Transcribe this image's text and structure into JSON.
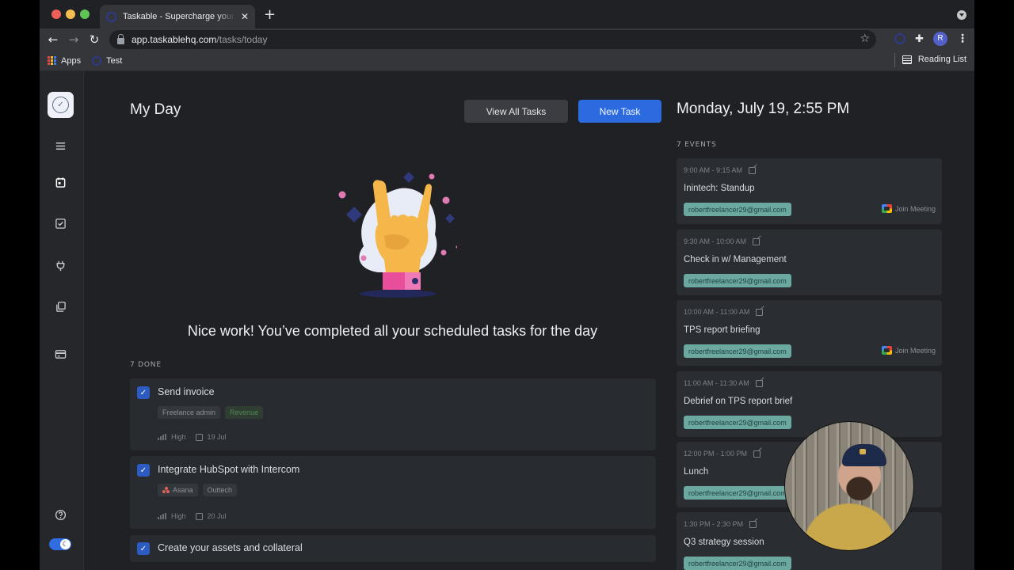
{
  "browser": {
    "tab_title": "Taskable - Supercharge your productivity",
    "tab_close": "✕",
    "new_tab": "+",
    "url_host": "app.taskablehq.com",
    "url_path": "/tasks/today",
    "back": "←",
    "forward": "→",
    "reload": "↻",
    "star": "☆",
    "puzzle": "✚",
    "profile_initial": "R",
    "menu": "⋮",
    "bookmarks": [
      {
        "label": "Apps"
      },
      {
        "label": "Test"
      }
    ],
    "reading_list": "Reading List"
  },
  "sidebar": {
    "logo_check": "✓",
    "items": [
      {
        "name": "menu"
      },
      {
        "name": "today"
      },
      {
        "name": "tasks"
      },
      {
        "name": "integrations"
      },
      {
        "name": "projects"
      },
      {
        "name": "billing"
      }
    ],
    "help": "?",
    "dark_mode_on": true,
    "moon": "☾"
  },
  "main": {
    "title": "My Day",
    "view_all_label": "View All Tasks",
    "new_task_label": "New Task",
    "celebrate": "Nice work! You’ve completed all your scheduled tasks for the day",
    "done_label": "7 DONE",
    "tasks": [
      {
        "title": "Send invoice",
        "checked": true,
        "tags": [
          "Freelance admin",
          "Revenue"
        ],
        "priority": "High",
        "due": "19 Jul"
      },
      {
        "title": "Integrate HubSpot with Intercom",
        "checked": true,
        "tags": [
          "Asana",
          "Outtech"
        ],
        "priority": "High",
        "due": "20 Jul"
      },
      {
        "title": "Create your assets and collateral",
        "checked": true
      }
    ],
    "check_glyph": "✓"
  },
  "events_panel": {
    "date": "Monday, July 19, 2:55 PM",
    "events_label": "7 EVENTS",
    "join_label": "Join Meeting",
    "events": [
      {
        "time": "9:00 AM - 9:15 AM",
        "title": "Inintech: Standup",
        "email": "robertfreelancer29@gmail.com",
        "join": true
      },
      {
        "time": "9:30 AM - 10:00 AM",
        "title": "Check in w/ Management",
        "email": "robertfreelancer29@gmail.com",
        "join": false
      },
      {
        "time": "10:00 AM - 11:00 AM",
        "title": "TPS report briefing",
        "email": "robertfreelancer29@gmail.com",
        "join": true
      },
      {
        "time": "11:00 AM - 11:30 AM",
        "title": "Debrief on TPS report brief",
        "email": "robertfreelancer29@gmail.com",
        "join": false
      },
      {
        "time": "12:00 PM - 1:00 PM",
        "title": "Lunch",
        "email": "robertfreelancer29@gmail.com",
        "join": false
      },
      {
        "time": "1:30 PM - 2:30 PM",
        "title": "Q3 strategy session",
        "email": "robertfreelancer29@gmail.com",
        "join": false
      }
    ]
  },
  "colors": {
    "accent": "#2c6ae0",
    "email_chip": "#6ba9a0",
    "background": "#1f2124",
    "card": "#282b2f"
  }
}
